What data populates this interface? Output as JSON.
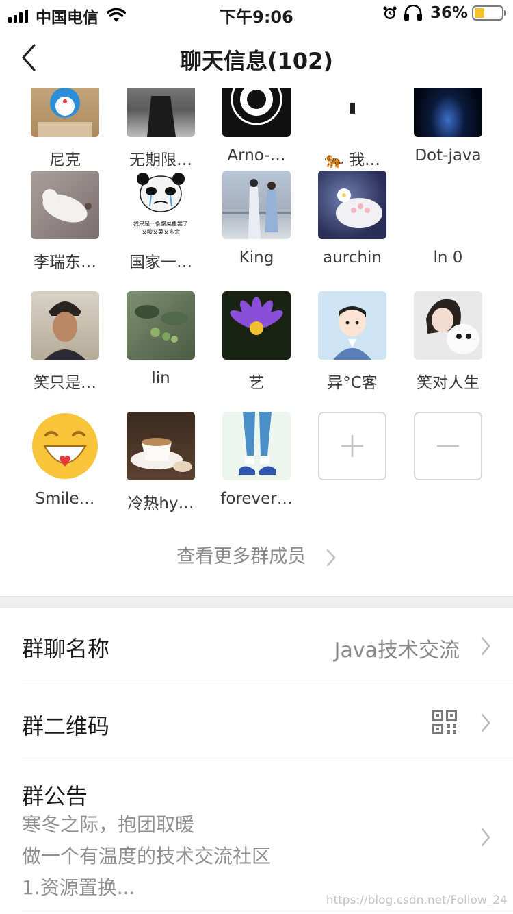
{
  "status_bar": {
    "carrier": "中国电信",
    "time": "下午9:06",
    "battery_percent": "36%",
    "battery_level": 0.36,
    "icons": [
      "signal-icon",
      "wifi-icon",
      "alarm-icon",
      "headphones-icon",
      "battery-icon"
    ]
  },
  "nav": {
    "title": "聊天信息(102)",
    "back_icon": "chevron-left-icon"
  },
  "members": [
    {
      "name": "尼克"
    },
    {
      "name": "无期限…"
    },
    {
      "name": "Arno-…"
    },
    {
      "name": "🐅 我…"
    },
    {
      "name": "Dot-java"
    },
    {
      "name": "李瑞东…"
    },
    {
      "name": "国家一…",
      "avatar_caption_1": "我只是一条酸菜鱼罢了",
      "avatar_caption_2": "又酸又菜又多余"
    },
    {
      "name": "King"
    },
    {
      "name": "aurchin"
    },
    {
      "name": "ln 0"
    },
    {
      "name": "笑只是…"
    },
    {
      "name": "lin"
    },
    {
      "name": "艺"
    },
    {
      "name": "异°C客"
    },
    {
      "name": "笑对人生"
    },
    {
      "name": "Smile…"
    },
    {
      "name": "冷热hy…"
    },
    {
      "name": "forever…"
    }
  ],
  "actions": {
    "add_icon": "plus-icon",
    "remove_icon": "minus-icon"
  },
  "more_members": {
    "label": "查看更多群成员"
  },
  "settings": {
    "group_name": {
      "label": "群聊名称",
      "value": "Java技术交流"
    },
    "qr_code": {
      "label": "群二维码",
      "icon": "qr-code-icon"
    },
    "announcement": {
      "label": "群公告",
      "line1": "寒冬之际，抱团取暖",
      "line2": "做一个有温度的技术交流社区",
      "line3": "1.资源置换..."
    }
  },
  "watermark": "https://blog.csdn.net/Follow_24",
  "colors": {
    "text_primary": "#1a1a1a",
    "text_secondary": "#888888",
    "divider": "#e3e3e3",
    "section_gap": "#eeeeee",
    "battery_fill": "#f3c12b"
  }
}
